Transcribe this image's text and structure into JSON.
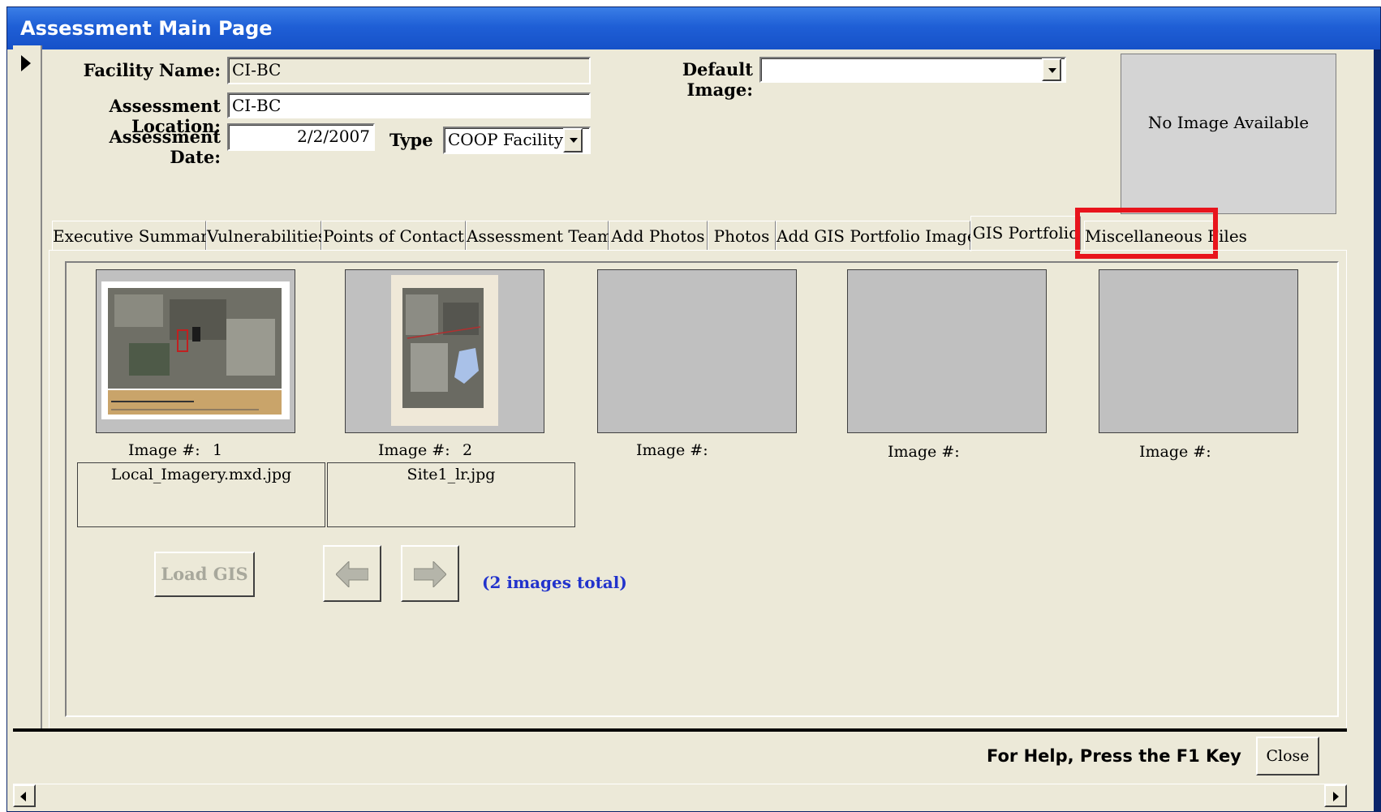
{
  "window": {
    "title": "Assessment Main Page"
  },
  "form": {
    "facility_name_label": "Facility Name:",
    "facility_name_value": "CI-BC",
    "assessment_location_label": "Assessment Location:",
    "assessment_location_value": "CI-BC",
    "assessment_date_label": "Assessment Date:",
    "assessment_date_value": "2/2/2007",
    "type_label": "Type",
    "type_value": "COOP Facility",
    "default_image_label": "Default Image:",
    "default_image_value": "",
    "no_image_text": "No Image Available"
  },
  "tabs": [
    {
      "label": "Executive Summary"
    },
    {
      "label": "Vulnerabilities"
    },
    {
      "label": "Points of Contact"
    },
    {
      "label": "Assessment Team"
    },
    {
      "label": "Add Photos"
    },
    {
      "label": "Photos"
    },
    {
      "label": "Add GIS Portfolio Images"
    },
    {
      "label": "GIS Portfolio",
      "active": true
    },
    {
      "label": "Miscellaneous Files",
      "highlighted": true
    }
  ],
  "gis": {
    "image_label": "Image #:",
    "slots": [
      {
        "number": "1",
        "filename": "Local_Imagery.mxd.jpg"
      },
      {
        "number": "2",
        "filename": "Site1_lr.jpg"
      },
      {
        "number": "",
        "filename": ""
      },
      {
        "number": "",
        "filename": ""
      },
      {
        "number": "",
        "filename": ""
      }
    ],
    "load_button": "Load GIS",
    "prev_icon": "left-arrow-icon",
    "next_icon": "right-arrow-icon",
    "total_text": "(2 images total)"
  },
  "footer": {
    "help_text": "For Help, Press the F1 Key",
    "close_button": "Close"
  },
  "colors": {
    "title_bar": "#1f5fd6",
    "form_bg": "#ece9d8",
    "highlight_box": "#e8141c",
    "total_text": "#2233cc"
  }
}
